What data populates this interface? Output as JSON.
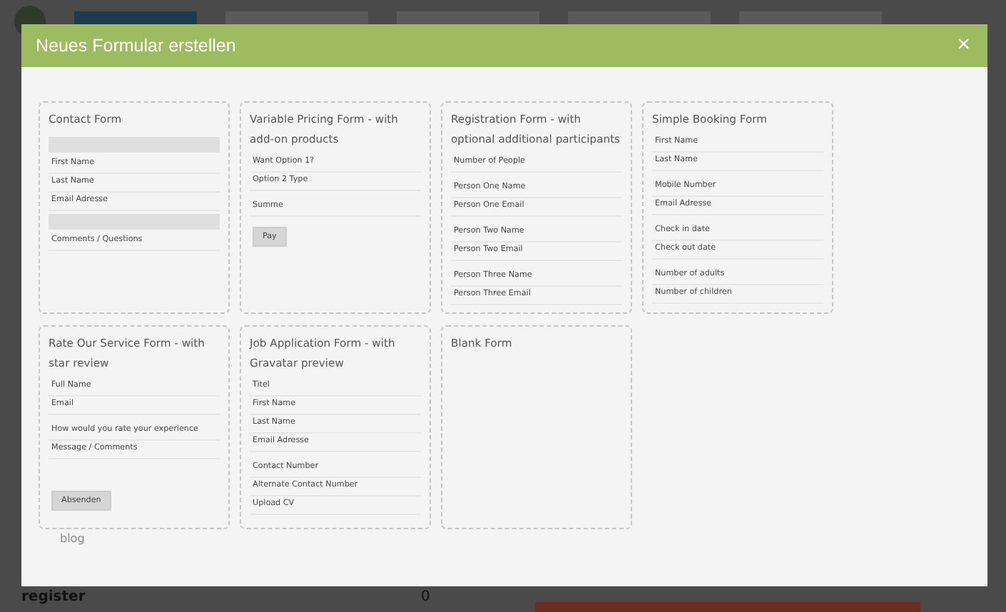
{
  "modal": {
    "title": "Neues Formular erstellen",
    "close": "×",
    "templates": [
      {
        "title": "Contact Form",
        "fields": [
          {
            "kind": "bar"
          },
          {
            "kind": "field",
            "label": "First Name"
          },
          {
            "kind": "field",
            "label": "Last Name"
          },
          {
            "kind": "field",
            "label": "Email Adresse"
          },
          {
            "kind": "bar"
          },
          {
            "kind": "field",
            "label": "Comments / Questions"
          }
        ]
      },
      {
        "title": "Variable Pricing Form - with add-on products",
        "fields": [
          {
            "kind": "field",
            "label": "Want Option 1?"
          },
          {
            "kind": "field",
            "label": "Option 2 Type"
          },
          {
            "kind": "spacer"
          },
          {
            "kind": "field",
            "label": "Summe"
          },
          {
            "kind": "button",
            "label": "Pay"
          }
        ]
      },
      {
        "title": "Registration Form - with optional additional participants",
        "fields": [
          {
            "kind": "field",
            "label": "Number of People"
          },
          {
            "kind": "spacer"
          },
          {
            "kind": "field",
            "label": "Person One Name"
          },
          {
            "kind": "field",
            "label": "Person One Email"
          },
          {
            "kind": "spacer"
          },
          {
            "kind": "field",
            "label": "Person Two Name"
          },
          {
            "kind": "field",
            "label": "Person Two Email"
          },
          {
            "kind": "spacer"
          },
          {
            "kind": "field",
            "label": "Person Three Name"
          },
          {
            "kind": "field",
            "label": "Person Three Email"
          }
        ]
      },
      {
        "title": "Simple Booking Form",
        "fields": [
          {
            "kind": "field",
            "label": "First Name"
          },
          {
            "kind": "field",
            "label": "Last Name"
          },
          {
            "kind": "spacer"
          },
          {
            "kind": "field",
            "label": "Mobile Number"
          },
          {
            "kind": "field",
            "label": "Email Adresse"
          },
          {
            "kind": "spacer"
          },
          {
            "kind": "field",
            "label": "Check in date"
          },
          {
            "kind": "field",
            "label": "Check out date"
          },
          {
            "kind": "spacer"
          },
          {
            "kind": "field",
            "label": "Number of adults"
          },
          {
            "kind": "field",
            "label": "Number of children"
          }
        ]
      },
      {
        "title": "Rate Our Service Form - with star review",
        "fields": [
          {
            "kind": "field",
            "label": "Full Name"
          },
          {
            "kind": "field",
            "label": "Email"
          },
          {
            "kind": "spacer"
          },
          {
            "kind": "field",
            "label": "How would you rate your experience"
          },
          {
            "kind": "field",
            "label": "Message / Comments"
          },
          {
            "kind": "spacer"
          },
          {
            "kind": "spacer"
          },
          {
            "kind": "spacer"
          },
          {
            "kind": "button",
            "label": "Absenden"
          }
        ]
      },
      {
        "title": "Job Application Form - with Gravatar preview",
        "fields": [
          {
            "kind": "field",
            "label": "Titel"
          },
          {
            "kind": "field",
            "label": "First Name"
          },
          {
            "kind": "field",
            "label": "Last Name"
          },
          {
            "kind": "field",
            "label": "Email Adresse"
          },
          {
            "kind": "spacer"
          },
          {
            "kind": "field",
            "label": "Contact Number"
          },
          {
            "kind": "field",
            "label": "Alternate Contact Number"
          },
          {
            "kind": "field",
            "label": "Upload CV"
          }
        ]
      },
      {
        "title": "Blank Form"
      }
    ],
    "footer_text": "blog"
  },
  "background": {
    "row_label": "register",
    "row_count": "0"
  }
}
